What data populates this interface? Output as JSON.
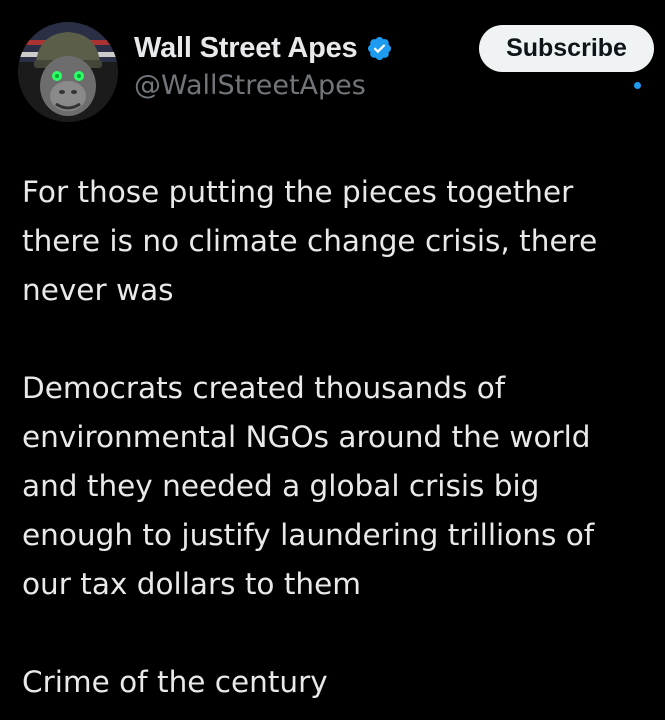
{
  "author": {
    "display_name": "Wall Street Apes",
    "handle": "@WallStreetApes",
    "verified": true,
    "avatar_icon": "gorilla-helmet-avatar"
  },
  "actions": {
    "subscribe_label": "Subscribe"
  },
  "colors": {
    "background": "#000000",
    "text": "#e7e9ea",
    "secondary_text": "#71767b",
    "verified_blue": "#1d9bf0",
    "subscribe_bg": "#eff3f4"
  },
  "post": {
    "paragraphs": [
      {
        "lines": [
          "For those putting the pieces together",
          "there is no climate change crisis, there",
          "never was"
        ]
      },
      {
        "lines": [
          "Democrats created thousands of",
          "environmental NGOs around the world",
          "and they needed a global crisis big",
          "enough to justify laundering trillions of",
          "our tax dollars to them"
        ]
      },
      {
        "lines": [
          "Crime of the century"
        ]
      }
    ]
  }
}
